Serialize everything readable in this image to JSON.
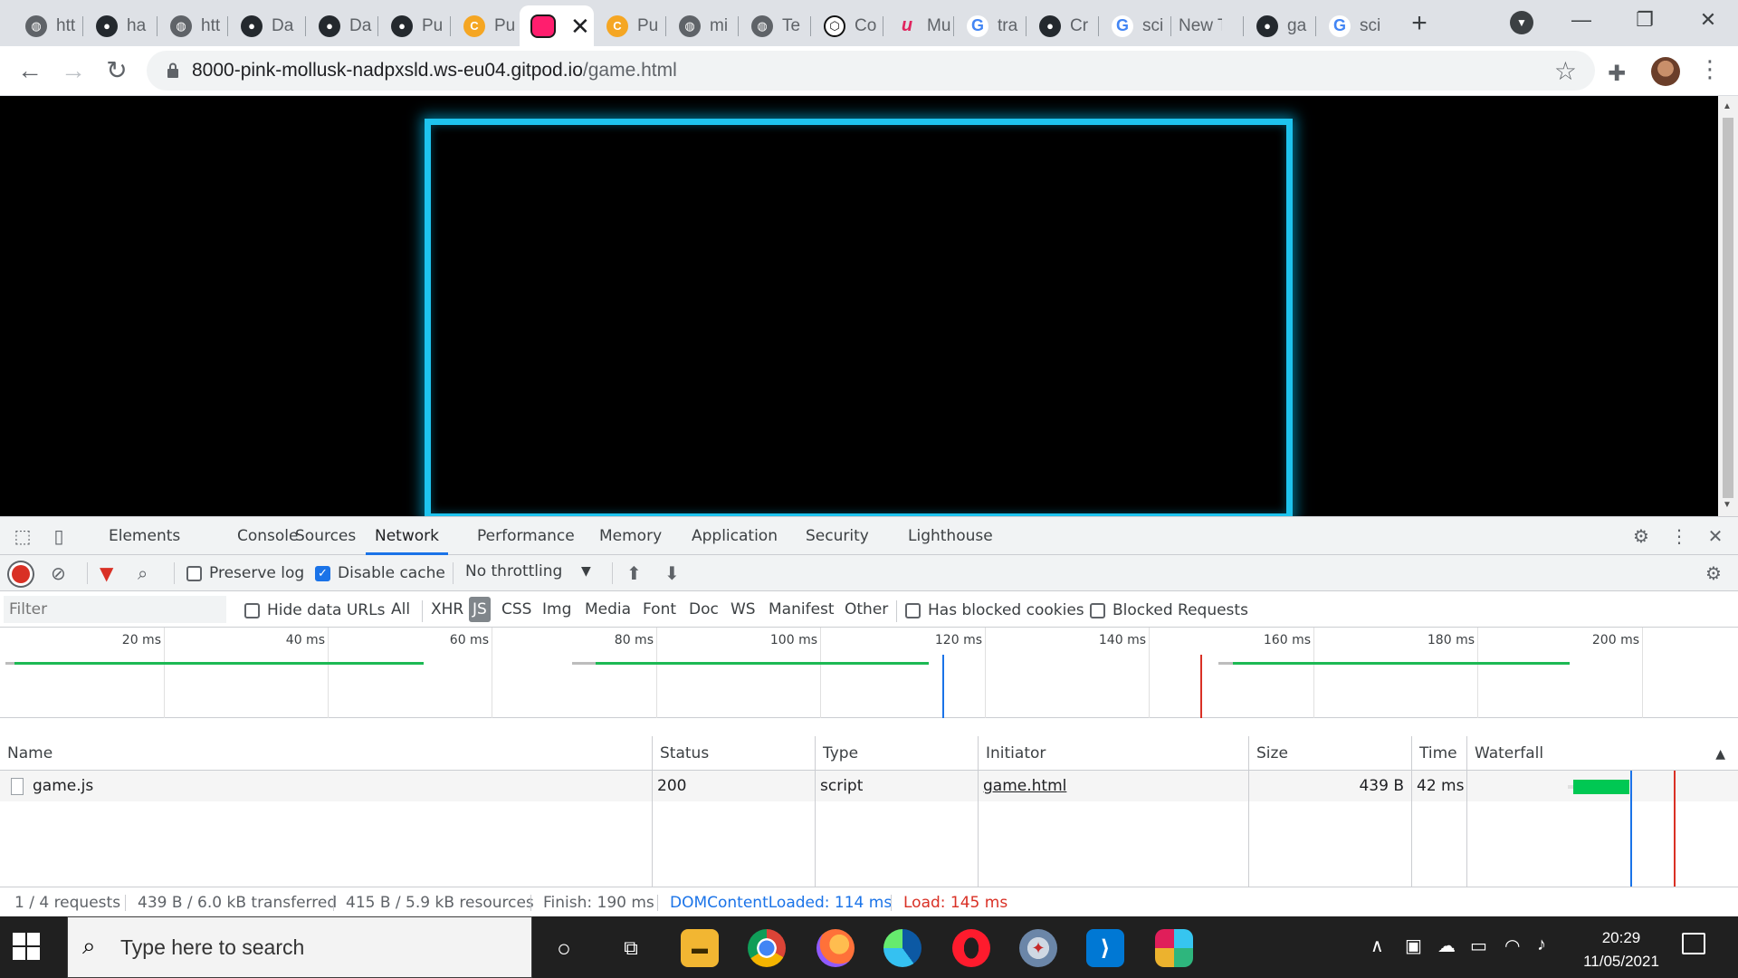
{
  "tabs": [
    {
      "label": "htt",
      "icon": "globe-icon",
      "active": false
    },
    {
      "label": "ha",
      "icon": "github-icon",
      "active": false
    },
    {
      "label": "htt",
      "icon": "globe-icon",
      "active": false
    },
    {
      "label": "Da",
      "icon": "github-icon",
      "active": false
    },
    {
      "label": "Da",
      "icon": "github-icon",
      "active": false
    },
    {
      "label": "Pu",
      "icon": "github-icon",
      "active": false
    },
    {
      "label": "Pu",
      "icon": "codepen-pu-icon",
      "active": false
    },
    {
      "label": "",
      "icon": "pink-square-icon",
      "active": true
    },
    {
      "label": "Pu",
      "icon": "codepen-pu-icon",
      "active": false
    },
    {
      "label": "mi",
      "icon": "globe-icon",
      "active": false
    },
    {
      "label": "Te",
      "icon": "globe-icon",
      "active": false
    },
    {
      "label": "Co",
      "icon": "codesandbox-icon",
      "active": false
    },
    {
      "label": "Mu",
      "icon": "m-logo-icon",
      "active": false
    },
    {
      "label": "tra",
      "icon": "google-icon",
      "active": false
    },
    {
      "label": "Cr",
      "icon": "github-icon",
      "active": false
    },
    {
      "label": "sci",
      "icon": "google-icon",
      "active": false
    },
    {
      "label": "New Ta",
      "icon": "",
      "active": false
    },
    {
      "label": "ga",
      "icon": "github-icon",
      "active": false
    },
    {
      "label": "sci",
      "icon": "google-icon",
      "active": false
    }
  ],
  "active_tab_close": "✕",
  "new_tab_label": "+",
  "window_controls": {
    "minimize": "—",
    "restore": "❐",
    "close": "✕"
  },
  "address": {
    "host": "8000-pink-mollusk-nadpxsld.ws-eu04.gitpod.io",
    "path": "/game.html"
  },
  "devtools": {
    "tabs": [
      "Elements",
      "Console",
      "Sources",
      "Network",
      "Performance",
      "Memory",
      "Application",
      "Security",
      "Lighthouse"
    ],
    "active_tab": "Network",
    "netbar": {
      "preserve_log": "Preserve log",
      "preserve_log_checked": false,
      "disable_cache": "Disable cache",
      "disable_cache_checked": true,
      "throttling": "No throttling"
    },
    "filter": {
      "placeholder": "Filter",
      "hide_data_urls": "Hide data URLs",
      "types": [
        "All",
        "XHR",
        "JS",
        "CSS",
        "Img",
        "Media",
        "Font",
        "Doc",
        "WS",
        "Manifest",
        "Other"
      ],
      "active_type": "JS",
      "has_blocked_cookies": "Has blocked cookies",
      "blocked_requests": "Blocked Requests"
    },
    "overview_ticks": [
      "20 ms",
      "40 ms",
      "60 ms",
      "80 ms",
      "100 ms",
      "120 ms",
      "140 ms",
      "160 ms",
      "180 ms",
      "200 ms"
    ],
    "columns": [
      "Name",
      "Status",
      "Type",
      "Initiator",
      "Size",
      "Time",
      "Waterfall"
    ],
    "requests": [
      {
        "name": "game.js",
        "status": "200",
        "type": "script",
        "initiator": "game.html",
        "size": "439 B",
        "time": "42 ms"
      }
    ],
    "summary": {
      "requests": "1 / 4 requests",
      "transferred": "439 B / 6.0 kB transferred",
      "resources": "415 B / 5.9 kB resources",
      "finish": "Finish: 190 ms",
      "dom_content_loaded": "DOMContentLoaded: 114 ms",
      "load": "Load: 145 ms"
    }
  },
  "taskbar": {
    "search_placeholder": "Type here to search",
    "apps": [
      "cortana-icon",
      "task-view-icon",
      "file-explorer-icon",
      "chrome-icon",
      "firefox-icon",
      "edge-icon",
      "opera-icon",
      "safari-icon",
      "vscode-icon",
      "slack-icon"
    ],
    "time": "20:29",
    "date": "11/05/2021"
  }
}
